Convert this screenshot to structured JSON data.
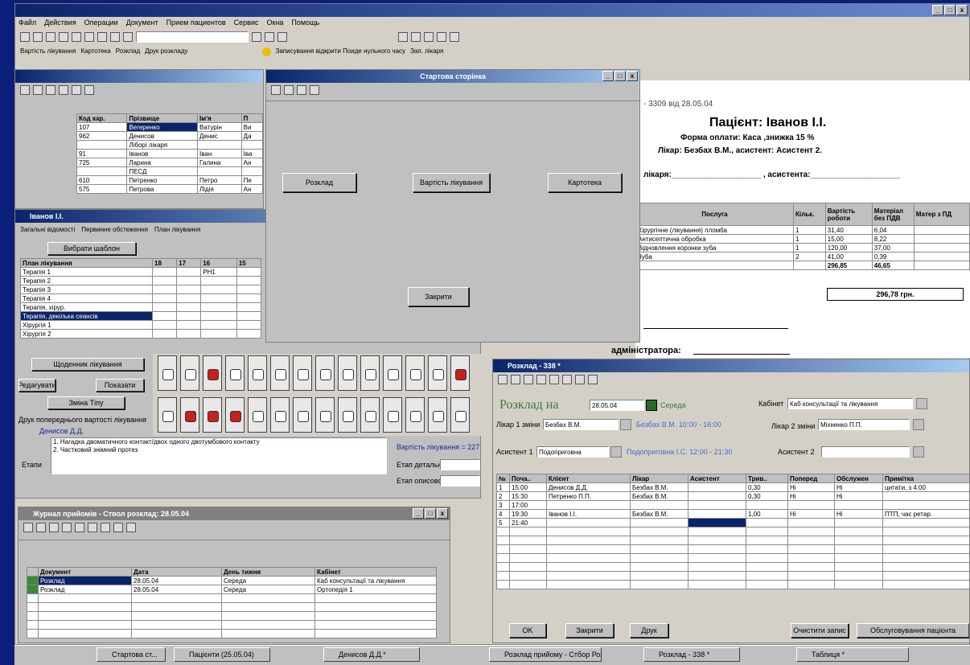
{
  "menu_bar": [
    "Файл",
    "Действия",
    "Операции",
    "Документ",
    "Прием пациентов",
    "Сервис",
    "Окна",
    "Помощь"
  ],
  "nav_bar": {
    "items": [
      "Вартість лікування",
      "Картотека",
      "Розклад",
      "Друк розкладу"
    ],
    "toolbar_text": "Записування відкрити Поиде нульного часу",
    "search_label": "Зап. лікаря"
  },
  "start_page": {
    "title": "Стартова сторінка",
    "btn_schedule": "Розклад",
    "btn_cost": "Вартість лікування",
    "btn_cards": "Картотека",
    "btn_close": "Закрити"
  },
  "patients": {
    "columns": [
      "Код кар.",
      "Прізвище",
      "Ім'я",
      "П"
    ],
    "rows": [
      [
        "107",
        "Вегеренко",
        "Ватурін",
        "Ви"
      ],
      [
        "962",
        "Денисов",
        "Денис",
        "Да"
      ],
      [
        "",
        "Ліборі лікаря",
        "",
        ""
      ],
      [
        "91",
        "Іванов",
        "Іван",
        "Іва"
      ],
      [
        "725",
        "Ларина",
        "Галина",
        "Ан"
      ],
      [
        "",
        "ПЕСД",
        "",
        ""
      ],
      [
        "610",
        "Петренко",
        "Петро",
        "Пе"
      ],
      [
        "575",
        "Петрова",
        "Лідія",
        "Ан"
      ]
    ]
  },
  "doctor_win": {
    "title": "Іванов І.І.",
    "tabs": [
      "Загальні відомості",
      "Первинне обстеження",
      "План лікування"
    ],
    "btn_choose": "Вибрати шаблон",
    "plan_header": "План лікування",
    "teeth_cols": [
      "18",
      "17",
      "16",
      "15"
    ],
    "plan_rows": [
      "Терапія 1",
      "Терапія 2",
      "Терапія 3",
      "Терапія 4",
      "Терапія, хірур.",
      "Терапія, декілька сеансів",
      "Хірургія 1",
      "Хірургія 2"
    ],
    "mark_16": "PH1",
    "btn_save": "Щоденник лікування",
    "btn_edit": "Редагувати",
    "btn_show": "Показати",
    "btn_formula": "Зміна Тіпу",
    "lbl_print": "Друк попереднього вартості лікування",
    "doctor_name": "Денисов Д.Д.",
    "lbl_stages": "Етапи",
    "stage_lines": [
      "1. Нагадка двоматичного контакт/двох одного двотумбового контакту",
      "2. Частковий знімний протез"
    ],
    "cost_label": "Вартість лікування = 227",
    "stage_detail": "Етап детально",
    "stage_general": "Етап описово"
  },
  "invoice": {
    "header": "- 3309 від 28.05.04",
    "patient": "Пацієнт: Іванов І.І.",
    "payment": "Форма оплати: Каса ,знижка 15 %",
    "doctor": "Лікар: Безбах В.М., асистент: Асистент 2.",
    "sign_label": "лікаря:____________________ , асистента:____________________",
    "columns": [
      "Послуга",
      "Кільк.",
      "Вартість роботи",
      "Матеріал без ПДВ",
      "Матер з ПД"
    ],
    "rows": [
      [
        "Хірургічне (лікування) пломба",
        "1",
        "31,40",
        "6,04",
        ""
      ],
      [
        "Антисептична обробка",
        "1",
        "15,00",
        "8,22",
        ""
      ],
      [
        "Відновлення коронки зуба",
        "1",
        "120,00",
        "37,00",
        ""
      ],
      [
        "Зуба",
        "2",
        "41,00",
        "0,39",
        ""
      ]
    ],
    "totals": [
      "296,85",
      "46,65"
    ],
    "total_label": "296,78 грн.",
    "admin_label": "адміністратора:"
  },
  "schedule": {
    "title": "Розклад - 338 *",
    "heading": "Розклад на",
    "date": "28.05.04",
    "weekday": "Середа",
    "lbl_cabinet": "Кабінет",
    "cabinet": "Каб консультації та лікування",
    "lbl_doc1": "Лікар 1 зміни",
    "doc1": "Безбах В.М.",
    "doc1_time": "Безбах В.М. 10:00 - 16:00",
    "lbl_doc2": "Лікар 2 зміни",
    "doc2": "Міхненко П.П.",
    "lbl_asst1": "Асистент 1",
    "asst1": "Подоприговна",
    "asst1_time": "Подоприговна І.С. 12:00 - 21:30",
    "lbl_asst2": "Асистент 2",
    "columns": [
      "№",
      "Поча..",
      "Клієнт",
      "Лікар",
      "Асистент",
      "Трив..",
      "Поперед",
      "Обслужен",
      "Примітка"
    ],
    "rows": [
      [
        "1",
        "15:00",
        "Денисов Д.Д.",
        "Безбах В.М.",
        "",
        "0,30",
        "Hi",
        "Hi",
        "цитати, з 4:00"
      ],
      [
        "2",
        "15:30",
        "Петренко П.П.",
        "Безбах В.М.",
        "",
        "0,30",
        "Hi",
        "Hi",
        ""
      ],
      [
        "3",
        "17:00",
        "",
        "",
        "",
        "",
        "",
        "",
        ""
      ],
      [
        "4",
        "19:30",
        "Іванов І.І.",
        "Безбах В.М.",
        "",
        "1,00",
        "Hi",
        "Hi",
        "ПТП, час ретар."
      ],
      [
        "5",
        "21:40",
        "",
        "",
        "",
        "",
        "",
        "",
        ""
      ]
    ],
    "btn_ok": "OK",
    "btn_close": "Закрити",
    "btn_print": "Друк",
    "btn_clear": "Очистити запис",
    "btn_service": "Обслуговування пацієнта"
  },
  "journal": {
    "title": "Журнал прийомів - Ствол розклад: 28.05.04",
    "columns": [
      "Документ",
      "Дата",
      "День тижня",
      "Кабінет"
    ],
    "rows": [
      [
        "Розклад",
        "28.05.04",
        "Середа",
        "Каб консультації та лікування"
      ],
      [
        "Розклад",
        "28.05.04",
        "Середа",
        "Ортопедія 1"
      ]
    ]
  },
  "taskbar": [
    "Стартова ст...",
    "Пацієнти (25.05.04)",
    "Денисов Д.Д.*",
    "Розклад прийому - Стбор Розкла...",
    "Розклад - 338 *",
    "Таблиця *"
  ]
}
